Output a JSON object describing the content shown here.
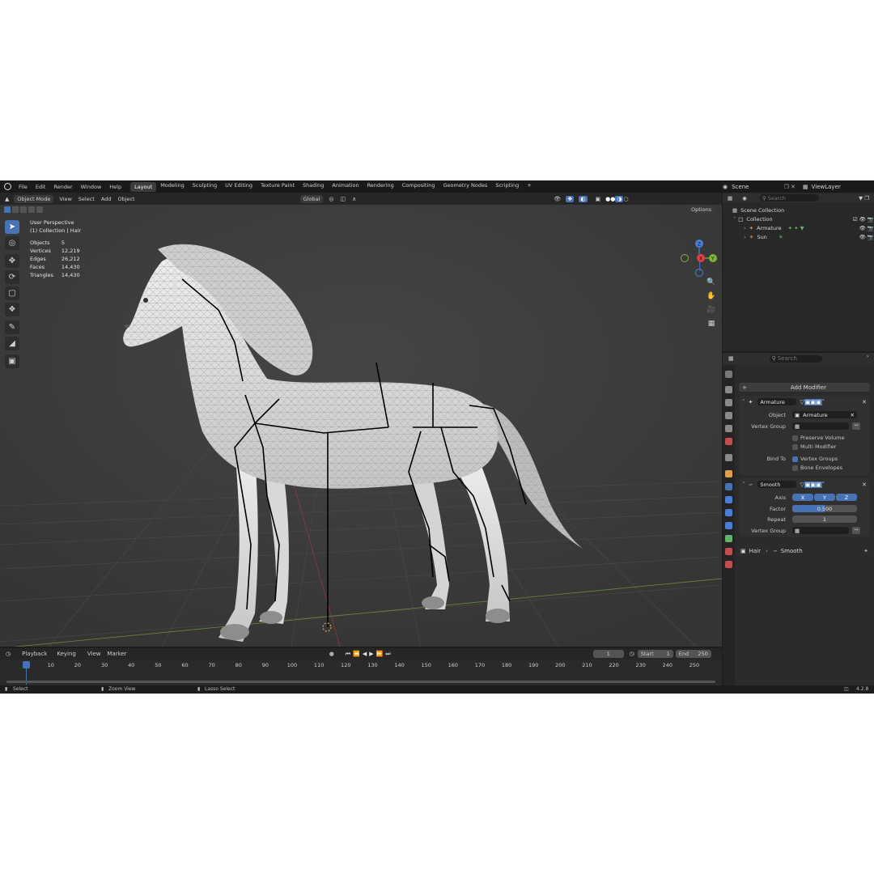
{
  "menu": [
    "File",
    "Edit",
    "Render",
    "Window",
    "Help"
  ],
  "workspaces": [
    {
      "label": "Layout",
      "active": true
    },
    {
      "label": "Modeling"
    },
    {
      "label": "Sculpting"
    },
    {
      "label": "UV Editing"
    },
    {
      "label": "Texture Paint"
    },
    {
      "label": "Shading"
    },
    {
      "label": "Animation"
    },
    {
      "label": "Rendering"
    },
    {
      "label": "Compositing"
    },
    {
      "label": "Geometry Nodes"
    },
    {
      "label": "Scripting"
    }
  ],
  "scene": {
    "label": "Scene",
    "view_layer": "ViewLayer"
  },
  "viewport_header": {
    "mode": "Object Mode",
    "menus": [
      "View",
      "Select",
      "Add",
      "Object"
    ],
    "orientation": "Global",
    "options": "Options"
  },
  "viewport": {
    "perspective": "User Perspective",
    "collection_line": "(1) Collection | Hair",
    "stats": [
      {
        "label": "Objects",
        "value": "5"
      },
      {
        "label": "Vertices",
        "value": "12,219"
      },
      {
        "label": "Edges",
        "value": "26,212"
      },
      {
        "label": "Faces",
        "value": "14,430"
      },
      {
        "label": "Triangles",
        "value": "14,430"
      }
    ],
    "gizmo": {
      "z": "Z",
      "x": "X",
      "y": "Y"
    }
  },
  "outliner": {
    "search_placeholder": "Search",
    "scene_collection": "Scene Collection",
    "collection": "Collection",
    "items": [
      "Armature",
      "Sun"
    ]
  },
  "properties": {
    "search_placeholder": "Search",
    "breadcrumb_object": "Hair",
    "breadcrumb_modifier": "Smooth",
    "add_modifier": "Add Modifier",
    "armature_modifier": {
      "name": "Armature",
      "object_label": "Object",
      "object_value": "Armature",
      "vertex_group_label": "Vertex Group",
      "preserve_volume": "Preserve Volume",
      "multi_modifier": "Multi Modifier",
      "bind_to_label": "Bind To",
      "vertex_groups": "Vertex Groups",
      "bone_envelopes": "Bone Envelopes"
    },
    "smooth_modifier": {
      "name": "Smooth",
      "axis_label": "Axis",
      "axes": [
        "X",
        "Y",
        "Z"
      ],
      "factor_label": "Factor",
      "factor_value": "0.500",
      "factor": 0.5,
      "repeat_label": "Repeat",
      "repeat_value": "1",
      "vertex_group_label": "Vertex Group"
    }
  },
  "timeline": {
    "menus": [
      "Playback",
      "Keying",
      "View",
      "Marker"
    ],
    "current_frame": "1",
    "start_label": "Start",
    "start": "1",
    "end_label": "End",
    "end": "250",
    "ticks": [
      "1",
      "10",
      "20",
      "30",
      "40",
      "50",
      "60",
      "70",
      "80",
      "90",
      "100",
      "110",
      "120",
      "130",
      "140",
      "150",
      "160",
      "170",
      "180",
      "190",
      "200",
      "210",
      "220",
      "230",
      "240",
      "250"
    ]
  },
  "statusbar": {
    "select": "Select",
    "zoom_view": "Zoom View",
    "lasso_select": "Lasso Select",
    "version": "4.2.8"
  },
  "colors": {
    "accent": "#4772b3",
    "x_axis": "#e0403f",
    "y_axis": "#7fb33a",
    "z_axis": "#4a7ed8"
  }
}
